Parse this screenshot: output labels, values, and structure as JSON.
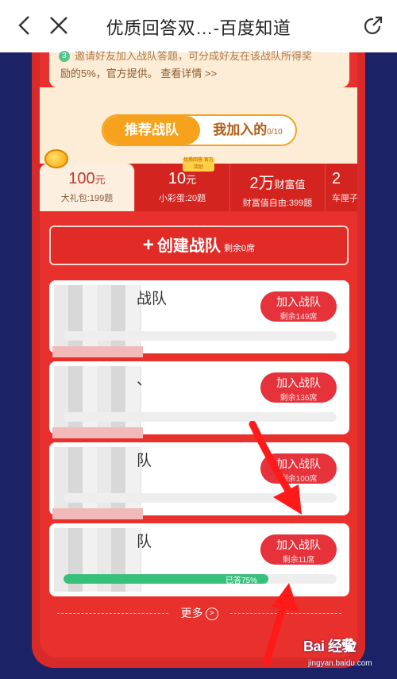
{
  "topbar": {
    "title": "优质回答双…-百度知道"
  },
  "notice": {
    "line1": "邀请好友加入战队答题，可分成好友在该战队所得奖",
    "line2": "励的5%，官方提供。  查看详情 >>"
  },
  "segment": {
    "active": "推荐战队",
    "inactive": "我加入的",
    "inactive_count": "0/10"
  },
  "reward_tabs": [
    {
      "value": "100",
      "unit": "元",
      "sub": "大礼包:199题"
    },
    {
      "value": "10",
      "unit": "元",
      "sub": "小彩蛋:20题"
    },
    {
      "value": "2万",
      "unit": "财富值",
      "sub": "财富值自由:399题"
    },
    {
      "value": "2",
      "unit": "",
      "sub": "车厘子"
    }
  ],
  "tag_text": "优质回答 官方奖励",
  "create": {
    "label": "创建战队",
    "remaining": "剩余0席"
  },
  "teams": [
    {
      "name": "战队",
      "join": "加入战队",
      "remaining": "剩余149席",
      "progress": 0
    },
    {
      "name": "、",
      "join": "加入战队",
      "remaining": "剩余136席",
      "progress": 0
    },
    {
      "name": "队",
      "join": "加入战队",
      "remaining": "剩余100席",
      "progress": 0
    },
    {
      "name": "队",
      "join": "加入战队",
      "remaining": "剩余11席",
      "progress": 0.75,
      "progress_label": "已答75%"
    }
  ],
  "more": "更多",
  "watermark": {
    "brand": "Bai 经验",
    "url": "jingyan.baidu.com"
  },
  "colors": {
    "page_bg": "#1b2366",
    "panel_red": "#e8302c",
    "accent_orange": "#f6a21d",
    "join_red": "#e5323b",
    "progress_green": "#37c07a"
  }
}
